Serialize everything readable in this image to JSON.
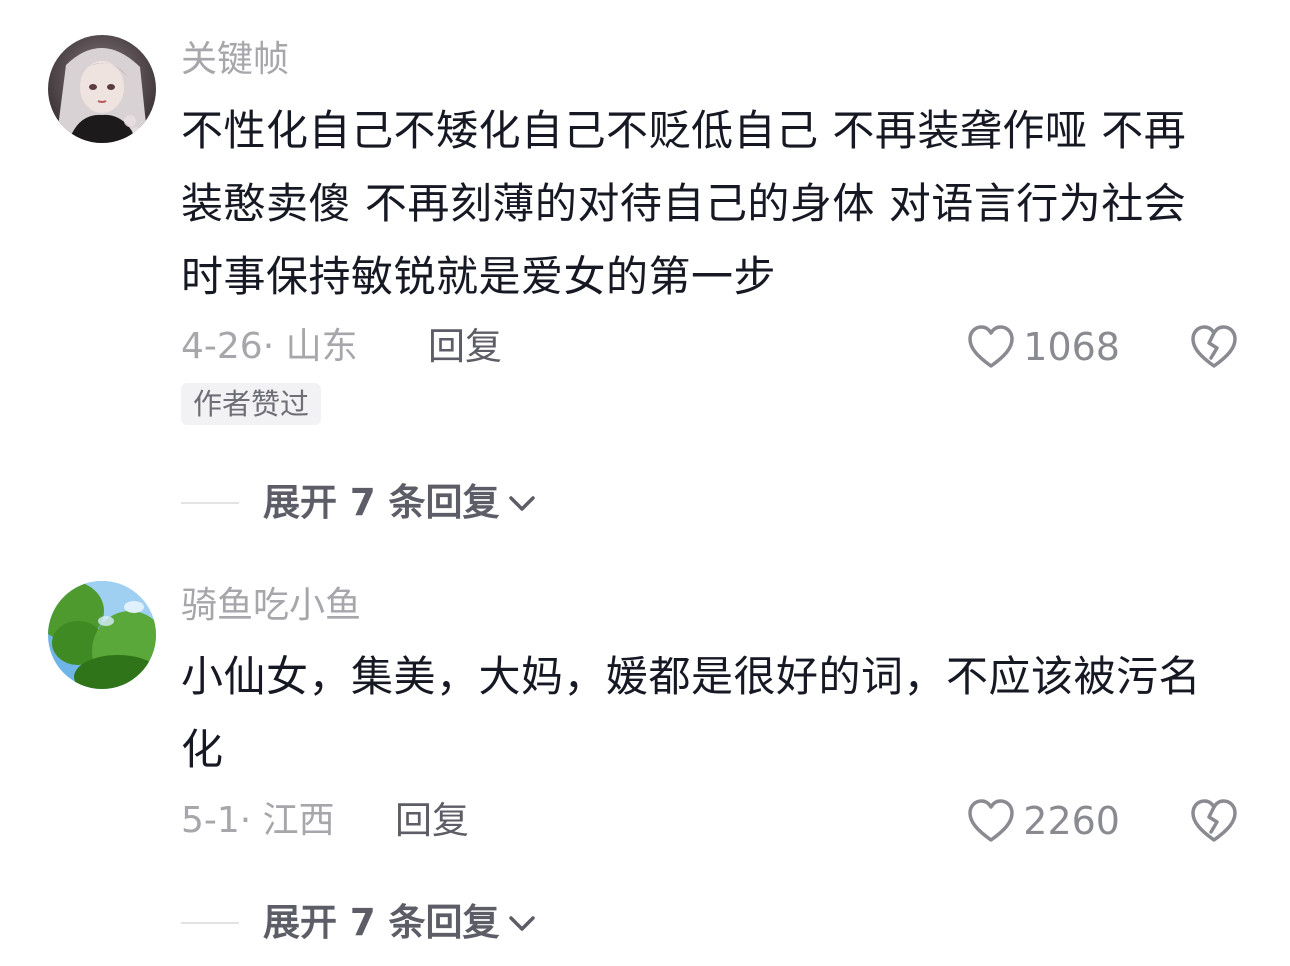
{
  "comments": [
    {
      "username": "关键帧",
      "text": "不性化自己不矮化自己不贬低自己 不再装聋作哑 不再装憨卖傻 不再刻薄的对待自己的身体 对语言行为社会时事保持敏锐就是爱女的第一步",
      "date_location": "4-26· 山东",
      "reply_label": "回复",
      "like_count": "1068",
      "badge": "作者赞过",
      "expand_label": "展开 7 条回复",
      "avatar_icon": "anime-girl-avatar"
    },
    {
      "username": "骑鱼吃小鱼",
      "text": "小仙女，集美，大妈，媛都是很好的词，不应该被污名化",
      "date_location": "5-1· 江西",
      "reply_label": "回复",
      "like_count": "2260",
      "badge": "",
      "expand_label": "展开 7 条回复",
      "avatar_icon": "green-leaves-sky-avatar"
    }
  ],
  "colors": {
    "username": "#a6a6ab",
    "text": "#161823",
    "meta": "#a6a6ab",
    "accent_reply": "#5c5d66",
    "badge_bg": "#f2f2f4"
  }
}
